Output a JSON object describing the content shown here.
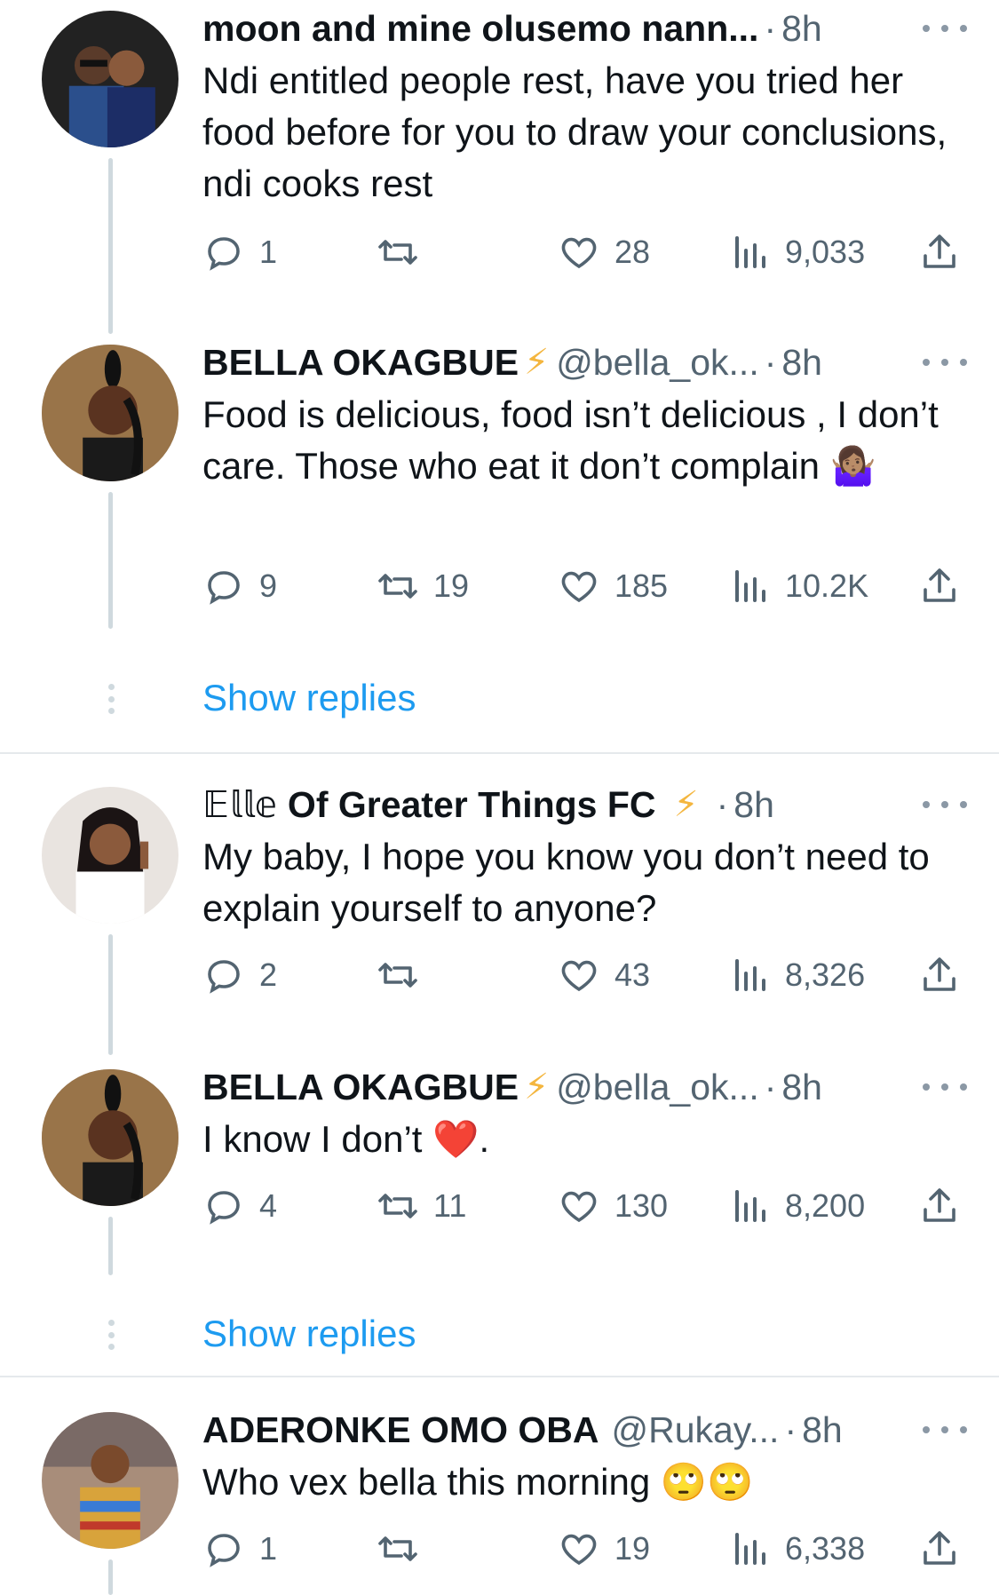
{
  "colors": {
    "accent": "#1d9bf0",
    "muted": "#536471",
    "bolt": "#f4b63f",
    "heart_emoji": "#e0202c"
  },
  "tweets": [
    {
      "name": "moon and mine olusemo nann...",
      "handle": "",
      "time": "8h",
      "text": "Ndi entitled people rest, have you tried her food before for you to draw your conclusions, ndi cooks rest",
      "replies": "1",
      "retweets": "",
      "likes": "28",
      "views": "9,033"
    },
    {
      "name": "BELLA OKAGBUE",
      "bolt": "⚡",
      "handle": "@bella_ok...",
      "time": "8h",
      "text": "Food is delicious, food isn’t delicious , I don’t care. Those who eat it don’t complain",
      "emoji": "🤷🏽‍♀️",
      "replies": "9",
      "retweets": "19",
      "likes": "185",
      "views": "10.2K"
    },
    {
      "name_prefix": "𝔼𝕝𝕝𝕖",
      "name": "Of Greater Things FC",
      "bolt": "⚡",
      "handle": "",
      "time": "8h",
      "text": "My baby, I hope you know you don’t need to explain yourself to anyone?",
      "replies": "2",
      "retweets": "",
      "likes": "43",
      "views": "8,326"
    },
    {
      "name": "BELLA OKAGBUE",
      "bolt": "⚡",
      "handle": "@bella_ok...",
      "time": "8h",
      "text": "I know I don’t",
      "emoji": "❤️",
      "suffix": ".",
      "replies": "4",
      "retweets": "11",
      "likes": "130",
      "views": "8,200"
    },
    {
      "name": "ADERONKE OMO OBA",
      "handle": "@Rukay...",
      "time": "8h",
      "text": "Who vex bella this morning",
      "emoji": "🙄🙄",
      "replies": "1",
      "retweets": "",
      "likes": "19",
      "views": "6,338"
    }
  ],
  "show_replies_label": "Show replies",
  "separator": "·",
  "icons": [
    "reply-icon",
    "retweet-icon",
    "like-icon",
    "views-icon",
    "share-icon",
    "more-icon"
  ]
}
